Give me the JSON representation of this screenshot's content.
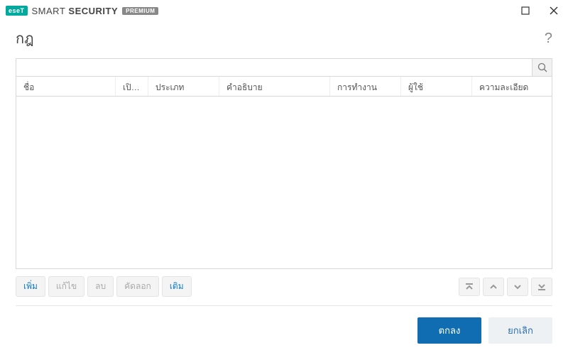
{
  "titlebar": {
    "logo_badge": "eseT",
    "product_light": "SMART",
    "product_bold": "SECURITY",
    "premium": "PREMIUM"
  },
  "header": {
    "title": "กฎ"
  },
  "search": {
    "placeholder": ""
  },
  "columns": {
    "name": "ชื่อ",
    "enabled": "เปิดใ...",
    "type": "ประเภท",
    "description": "คำอธิบาย",
    "action": "การทำงาน",
    "user": "ผู้ใช้",
    "details": "ความละเอียด"
  },
  "rows": [],
  "toolbar": {
    "add": "เพิ่ม",
    "edit": "แก้ไข",
    "delete": "ลบ",
    "copy": "คัดลอก",
    "more": "เติม"
  },
  "footer": {
    "ok": "ตกลง",
    "cancel": "ยกเลิก"
  }
}
